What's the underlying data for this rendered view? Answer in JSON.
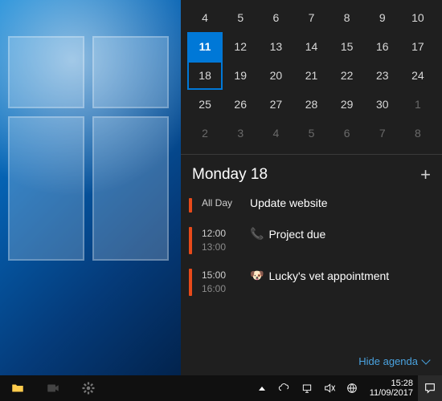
{
  "calendar": {
    "today": 11,
    "selected": 18,
    "rows": [
      {
        "cells": [
          {
            "d": 4
          },
          {
            "d": 5
          },
          {
            "d": 6
          },
          {
            "d": 7
          },
          {
            "d": 8
          },
          {
            "d": 9
          },
          {
            "d": 10
          }
        ]
      },
      {
        "cells": [
          {
            "d": 11
          },
          {
            "d": 12
          },
          {
            "d": 13
          },
          {
            "d": 14
          },
          {
            "d": 15
          },
          {
            "d": 16
          },
          {
            "d": 17
          }
        ]
      },
      {
        "cells": [
          {
            "d": 18
          },
          {
            "d": 19
          },
          {
            "d": 20
          },
          {
            "d": 21
          },
          {
            "d": 22
          },
          {
            "d": 23
          },
          {
            "d": 24
          }
        ]
      },
      {
        "cells": [
          {
            "d": 25
          },
          {
            "d": 26
          },
          {
            "d": 27
          },
          {
            "d": 28
          },
          {
            "d": 29
          },
          {
            "d": 30
          },
          {
            "d": 1,
            "dim": true
          }
        ]
      },
      {
        "cells": [
          {
            "d": 2,
            "dim": true
          },
          {
            "d": 3,
            "dim": true
          },
          {
            "d": 4,
            "dim": true
          },
          {
            "d": 5,
            "dim": true
          },
          {
            "d": 6,
            "dim": true
          },
          {
            "d": 7,
            "dim": true
          },
          {
            "d": 8,
            "dim": true
          }
        ]
      }
    ]
  },
  "agenda": {
    "title": "Monday 18",
    "add_icon": "+",
    "hide_label": "Hide agenda",
    "events": [
      {
        "all_day": true,
        "all_day_label": "All Day",
        "text": "Update website",
        "bar": "short"
      },
      {
        "start": "12:00",
        "end": "13:00",
        "icon": "📞",
        "text": "Project due",
        "bar": "tall"
      },
      {
        "start": "15:00",
        "end": "16:00",
        "icon": "🐶",
        "text": "Lucky's vet appointment",
        "bar": "tall"
      }
    ]
  },
  "taskbar": {
    "clock_time": "15:28",
    "clock_date": "11/09/2017"
  }
}
